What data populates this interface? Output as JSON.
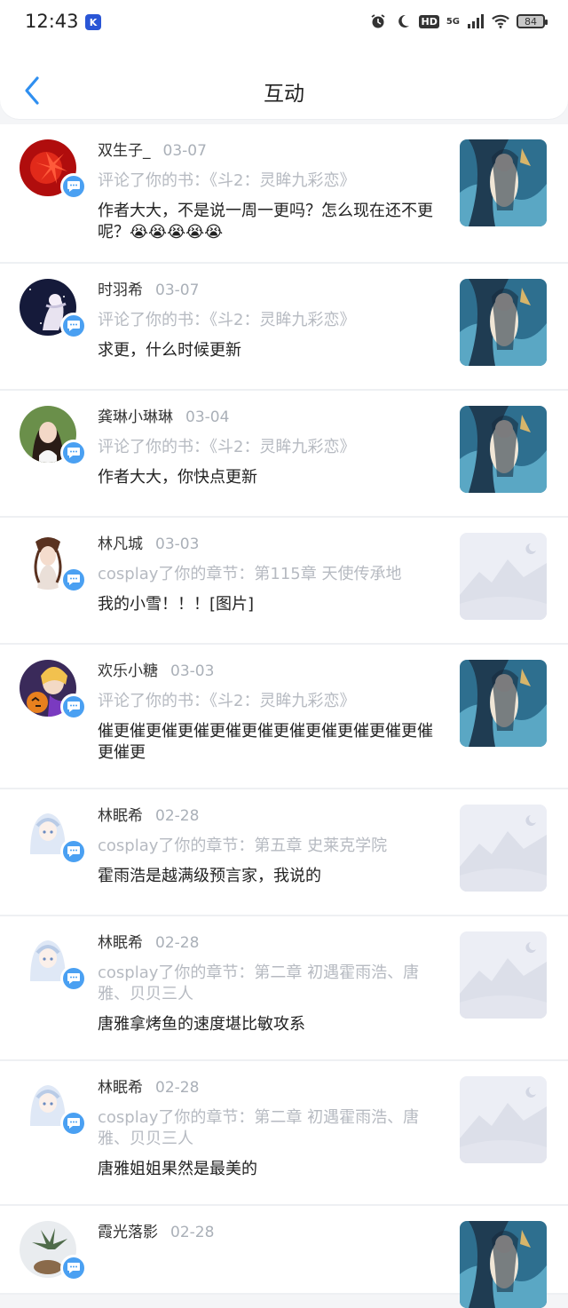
{
  "status_bar": {
    "time": "12:43",
    "app_badge": "K",
    "hd": "HD",
    "network": "5G",
    "battery": "84"
  },
  "header": {
    "title": "互动"
  },
  "items": [
    {
      "name": "双生子_",
      "date": "03-07",
      "action": "评论了你的书：《斗2：灵眸九彩恋》",
      "text": "作者大大，不是说一周一更吗？怎么现在还不更呢？😭😭😭😭😭"
    },
    {
      "name": "时羽希",
      "date": "03-07",
      "action": "评论了你的书：《斗2：灵眸九彩恋》",
      "text": "求更，什么时候更新"
    },
    {
      "name": "龚琳小琳琳",
      "date": "03-04",
      "action": "评论了你的书：《斗2：灵眸九彩恋》",
      "text": "作者大大，你快点更新"
    },
    {
      "name": "林凡城",
      "date": "03-03",
      "action": "cosplay了你的章节：第115章 天使传承地",
      "text": "我的小雪！！！[图片]"
    },
    {
      "name": "欢乐小糖",
      "date": "03-03",
      "action": "评论了你的书：《斗2：灵眸九彩恋》",
      "text": "催更催更催更催更催更催更催更催更催更催更催更催更"
    },
    {
      "name": "林眠希",
      "date": "02-28",
      "action": "cosplay了你的章节：第五章 史莱克学院",
      "text": "霍雨浩是越满级预言家，我说的"
    },
    {
      "name": "林眠希",
      "date": "02-28",
      "action": "cosplay了你的章节：第二章 初遇霍雨浩、唐雅、贝贝三人",
      "text": "唐雅拿烤鱼的速度堪比敏攻系"
    },
    {
      "name": "林眠希",
      "date": "02-28",
      "action": "cosplay了你的章节：第二章 初遇霍雨浩、唐雅、贝贝三人",
      "text": "唐雅姐姐果然是最美的"
    },
    {
      "name": "霞光落影",
      "date": "02-28",
      "action": "",
      "text": ""
    }
  ]
}
